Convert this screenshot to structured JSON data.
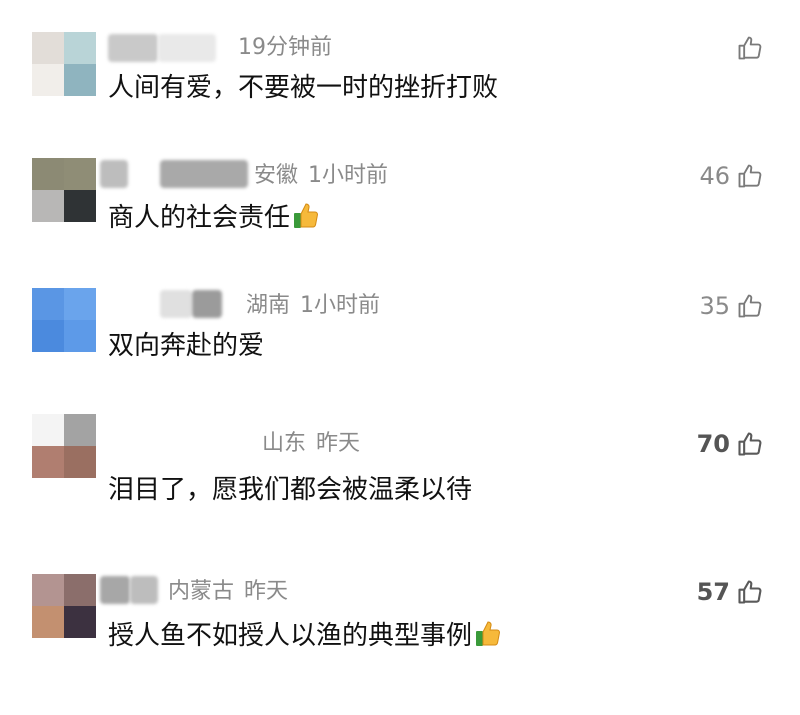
{
  "comments": [
    {
      "location": "",
      "time": "19分钟前",
      "text": "人间有爱，不要被一时的挫折打败",
      "likes": "",
      "has_emoji": false,
      "avatar_colors": [
        "#e2ddd8",
        "#b9d4d7",
        "#f1eeea",
        "#8fb4bf"
      ],
      "name_colors": [
        "#c9c9c9",
        "#e9e9e9"
      ]
    },
    {
      "location": "安徽",
      "time": "1小时前",
      "text": "商人的社会责任",
      "likes": "46",
      "has_emoji": true,
      "avatar_colors": [
        "#8c8a74",
        "#8f8d76",
        "#b8b7b6",
        "#2f3335"
      ],
      "name_colors": [
        "#bdbdbd",
        "#a9a9a9"
      ]
    },
    {
      "location": "湖南",
      "time": "1小时前",
      "text": "双向奔赴的爱",
      "likes": "35",
      "has_emoji": false,
      "avatar_colors": [
        "#5a96e4",
        "#6aa4ec",
        "#4b8ade",
        "#5d9ae8"
      ],
      "name_colors": [
        "#e0e0e0",
        "#9b9b9b"
      ]
    },
    {
      "location": "山东",
      "time": "昨天",
      "text": "泪目了，愿我们都会被温柔以待",
      "likes": "70",
      "has_emoji": false,
      "avatar_colors": [
        "#f4f4f4",
        "#a3a3a3",
        "#b07e70",
        "#9a6f61"
      ],
      "name_colors": [
        "#ffffff",
        "#ffffff"
      ]
    },
    {
      "location": "内蒙古",
      "time": "昨天",
      "text": "授人鱼不如授人以渔的典型事例",
      "likes": "57",
      "has_emoji": true,
      "avatar_colors": [
        "#b39491",
        "#8b6e6b",
        "#c39070",
        "#3c3140"
      ],
      "name_colors": [
        "#a7a7a7",
        "#bdbdbd"
      ]
    }
  ],
  "icons": {
    "like": "thumbs-up-outline-icon",
    "emoji": "thumbs-up-emoji-icon"
  }
}
